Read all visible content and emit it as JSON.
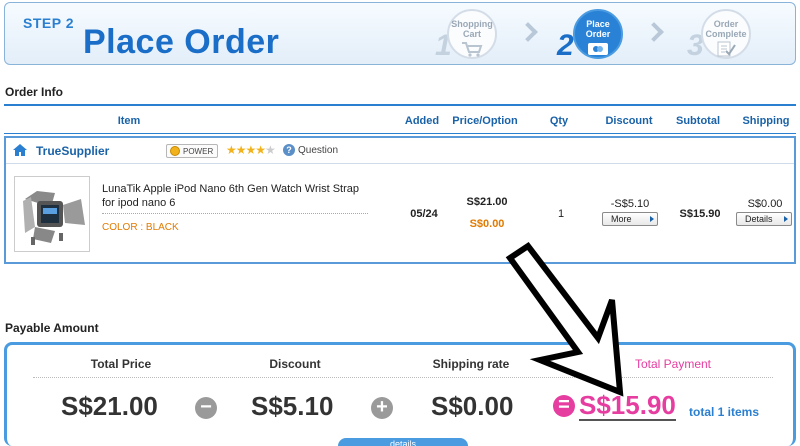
{
  "header": {
    "step_label": "STEP 2",
    "title": "Place Order",
    "steps": [
      {
        "num": "1",
        "label_line1": "Shopping",
        "label_line2": "Cart"
      },
      {
        "num": "2",
        "label_line1": "Place",
        "label_line2": "Order"
      },
      {
        "num": "3",
        "label_line1": "Order",
        "label_line2": "Complete"
      }
    ]
  },
  "order_info": {
    "title": "Order Info",
    "columns": [
      "Item",
      "Added",
      "Price/Option",
      "Qty",
      "Discount",
      "Subtotal",
      "Shipping"
    ],
    "supplier": {
      "name": "TrueSupplier",
      "badge": "POWER",
      "rating": 4,
      "question_label": "Question"
    },
    "product": {
      "name": "LunaTik Apple iPod Nano 6th Gen Watch Wrist Strap for ipod nano 6",
      "color": "COLOR : BLACK",
      "added": "05/24",
      "price": "S$21.00",
      "option_price": "S$0.00",
      "qty": "1",
      "discount": "-S$5.10",
      "discount_button": "More",
      "subtotal": "S$15.90",
      "shipping": "S$0.00",
      "shipping_button": "Details"
    }
  },
  "payable": {
    "title": "Payable Amount",
    "total_price_label": "Total Price",
    "discount_label": "Discount",
    "shipping_label": "Shipping rate",
    "total_payment_label": "Total Payment",
    "total_price": "S$21.00",
    "discount": "S$5.10",
    "shipping": "S$0.00",
    "total_payment": "S$15.90",
    "total_items": "total 1 items",
    "detail_tab": "details"
  },
  "colors": {
    "accent_blue": "#2a7fd0",
    "pink": "#e63da0",
    "orange": "#e07a00"
  }
}
